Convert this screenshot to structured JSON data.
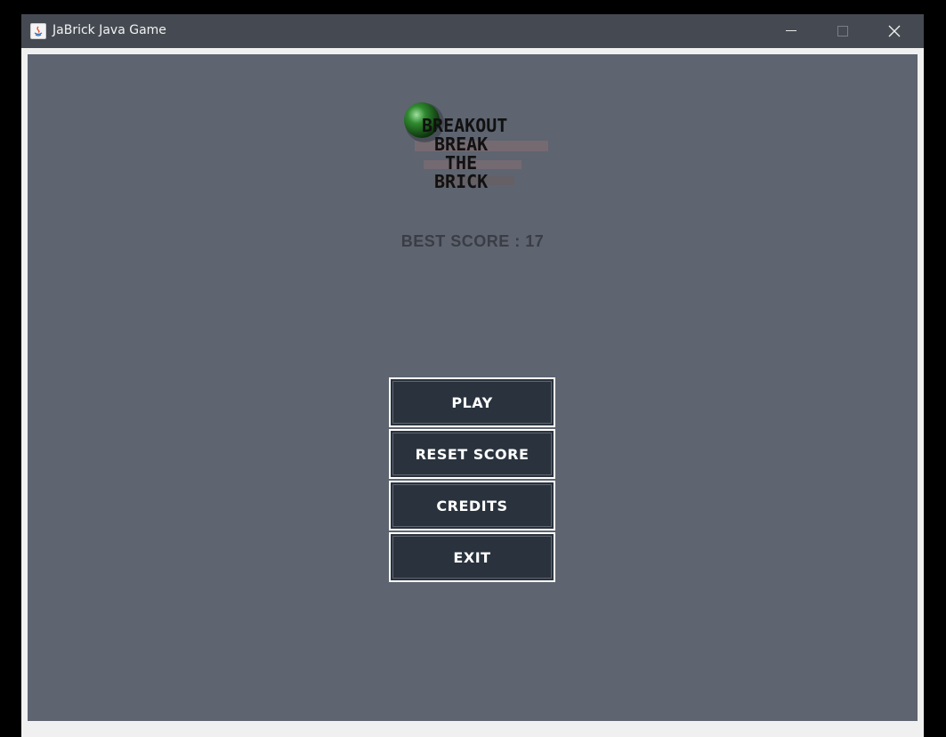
{
  "window": {
    "title": "JaBrick Java Game",
    "app_icon": "java-icon",
    "controls": {
      "minimize_icon": "minimize-icon",
      "maximize_icon": "maximize-icon",
      "close_icon": "close-icon"
    }
  },
  "game": {
    "logo": {
      "lines": [
        "BREAKOUT",
        "BREAK",
        "THE",
        "BRICK"
      ]
    },
    "best_score_text": "BEST SCORE : 17",
    "menu": {
      "play_label": "PLAY",
      "reset_score_label": "RESET SCORE",
      "credits_label": "CREDITS",
      "exit_label": "EXIT"
    }
  },
  "colors": {
    "game_background": "#5e6470",
    "button_background": "#2a333d",
    "button_border": "#ffffff",
    "title_bar": "#454a52"
  }
}
